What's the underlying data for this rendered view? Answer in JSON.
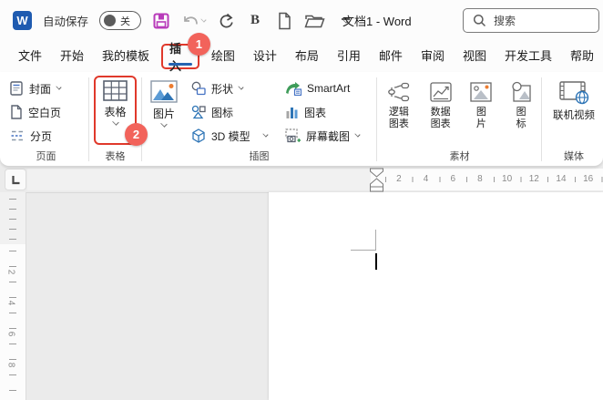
{
  "titlebar": {
    "logo_letter": "W",
    "autosave_label": "自动保存",
    "autosave_state": "关",
    "bold_label": "B",
    "document_title": "文档1 - Word",
    "search_placeholder": "搜索"
  },
  "tabs": {
    "items": [
      {
        "label": "文件"
      },
      {
        "label": "开始"
      },
      {
        "label": "我的模板"
      },
      {
        "label": "插入",
        "active": true
      },
      {
        "label": "绘图"
      },
      {
        "label": "设计"
      },
      {
        "label": "布局"
      },
      {
        "label": "引用"
      },
      {
        "label": "邮件"
      },
      {
        "label": "审阅"
      },
      {
        "label": "视图"
      },
      {
        "label": "开发工具"
      },
      {
        "label": "帮助"
      }
    ]
  },
  "annotations": {
    "step_1": "1",
    "step_2": "2",
    "box_color": "#e0392b",
    "badge_color": "#f2635b"
  },
  "ribbon": {
    "groups": {
      "page": {
        "label": "页面",
        "items": [
          {
            "label": "封面",
            "has_chevron": true
          },
          {
            "label": "空白页",
            "has_chevron": false
          },
          {
            "label": "分页",
            "has_chevron": false
          }
        ]
      },
      "table": {
        "label": "表格",
        "button": {
          "label": "表格",
          "has_chevron": true
        }
      },
      "illustrations": {
        "label": "插图",
        "picture": {
          "label": "图片",
          "has_chevron": true
        },
        "items": [
          {
            "label": "形状",
            "has_chevron": true
          },
          {
            "label": "图标",
            "has_chevron": false
          },
          {
            "label": "3D 模型",
            "has_chevron": true
          },
          {
            "label": "SmartArt",
            "has_chevron": false
          },
          {
            "label": "图表",
            "has_chevron": false
          },
          {
            "label": "屏幕截图",
            "has_chevron": true
          }
        ]
      },
      "assets": {
        "label": "素材",
        "items": [
          {
            "line1": "逻辑",
            "line2": "图表"
          },
          {
            "line1": "数据",
            "line2": "图表"
          },
          {
            "line1": "图",
            "line2": "片"
          },
          {
            "line1": "图",
            "line2": "标"
          }
        ]
      },
      "media": {
        "label": "媒体",
        "items": [
          {
            "label": "联机视频"
          }
        ]
      }
    }
  },
  "ruler": {
    "horizontal_numbers": [
      "2",
      "4",
      "6",
      "8",
      "10",
      "12",
      "14",
      "16"
    ],
    "vertical_numbers": [
      "2",
      "4",
      "6",
      "8"
    ]
  },
  "icons": {
    "word_logo": "blue-square-W",
    "autosave_toggle": "switch-off",
    "save": "floppy-disk",
    "undo": "curved-arrow-left",
    "redo": "circular-arrow",
    "new_document": "blank-page",
    "open_folder": "folder",
    "qat_customize": "bar-chevron-down",
    "search": "magnifier",
    "cover_page": "page-with-lines",
    "blank_page": "page-outline",
    "page_break": "blue-dashed-split",
    "table": "grid",
    "picture": "mountains-sun",
    "shapes": "circle-and-rect",
    "icon_set": "small-shapes",
    "model_3d": "cube",
    "smartart": "green-arrow-diagram",
    "chart": "bar-chart",
    "screenshot": "dashed-frame-plus",
    "logic_chart": "node-diagram",
    "data_chart": "framed-line-chart",
    "asset_picture": "outline-picture",
    "asset_icon": "outline-shapes",
    "online_video": "filmstrip-globe",
    "tab_stop": "L",
    "indent_markers": "hourglass"
  }
}
